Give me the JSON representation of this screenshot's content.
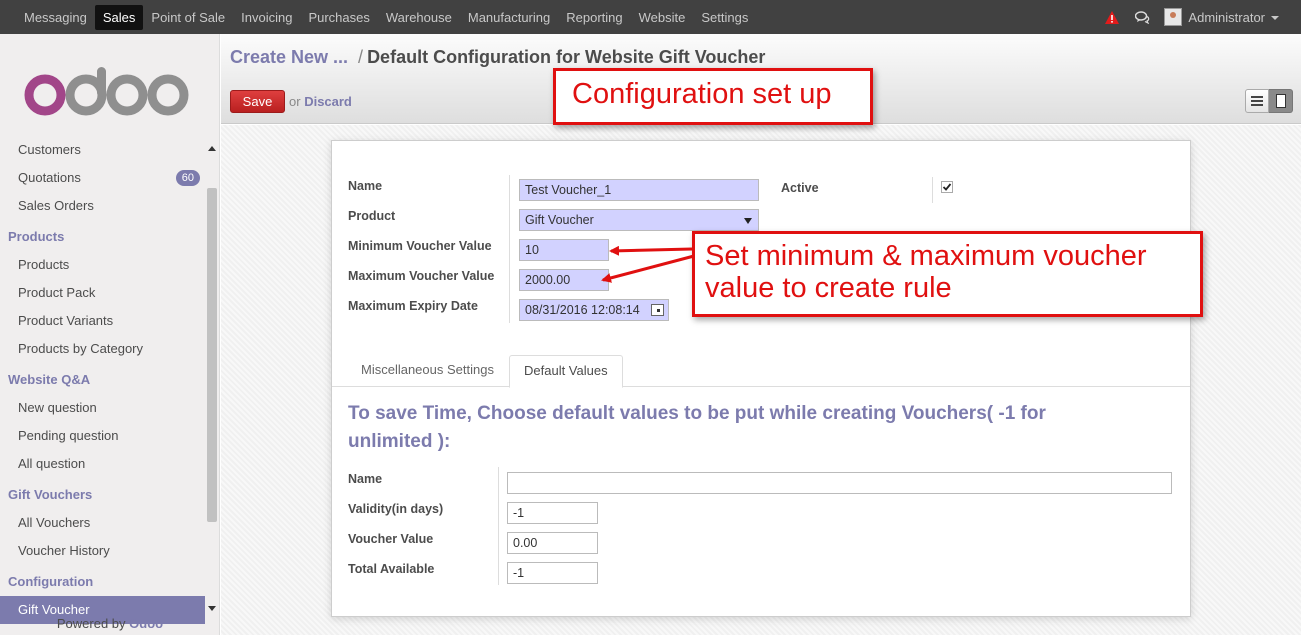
{
  "topbar": {
    "menu": [
      "Messaging",
      "Sales",
      "Point of Sale",
      "Invoicing",
      "Purchases",
      "Warehouse",
      "Manufacturing",
      "Reporting",
      "Website",
      "Settings"
    ],
    "active_index": 1,
    "user": "Administrator"
  },
  "sidebar": {
    "logo_text": "odoo",
    "items": [
      {
        "type": "item",
        "label": "Customers"
      },
      {
        "type": "item",
        "label": "Quotations",
        "badge": "60"
      },
      {
        "type": "item",
        "label": "Sales Orders"
      },
      {
        "type": "section",
        "label": "Products"
      },
      {
        "type": "item",
        "label": "Products"
      },
      {
        "type": "item",
        "label": "Product Pack"
      },
      {
        "type": "item",
        "label": "Product Variants"
      },
      {
        "type": "item",
        "label": "Products by Category"
      },
      {
        "type": "section",
        "label": "Website Q&A"
      },
      {
        "type": "item",
        "label": "New question"
      },
      {
        "type": "item",
        "label": "Pending question"
      },
      {
        "type": "item",
        "label": "All question"
      },
      {
        "type": "section",
        "label": "Gift Vouchers"
      },
      {
        "type": "item",
        "label": "All Vouchers"
      },
      {
        "type": "item",
        "label": "Voucher History"
      },
      {
        "type": "section",
        "label": "Configuration"
      },
      {
        "type": "item",
        "label": "Gift Voucher",
        "selected": true
      }
    ],
    "powered_by": "Powered by",
    "powered_brand": "Odoo"
  },
  "header": {
    "breadcrumb_parent": "Create New ...",
    "breadcrumb_sep": "/",
    "breadcrumb_current": "Default Configuration for Website Gift Voucher",
    "save_label": "Save",
    "or_label": "or",
    "discard_label": "Discard"
  },
  "form": {
    "name_label": "Name",
    "name_value": "Test Voucher_1",
    "product_label": "Product",
    "product_value": "Gift Voucher",
    "min_label": "Minimum Voucher Value",
    "min_value": "10",
    "max_label": "Maximum Voucher Value",
    "max_value": "2000.00",
    "expiry_label": "Maximum Expiry Date",
    "expiry_value": "08/31/2016 12:08:14",
    "active_label": "Active",
    "active_checked": true
  },
  "tabs": [
    {
      "label": "Miscellaneous Settings",
      "active": false
    },
    {
      "label": "Default Values",
      "active": true
    }
  ],
  "defaults": {
    "heading": "To save Time, Choose default values to be put while creating Vouchers( -1 for unlimited ):",
    "name_label": "Name",
    "name_value": "",
    "validity_label": "Validity(in days)",
    "validity_value": "-1",
    "voucher_value_label": "Voucher Value",
    "voucher_value_value": "0.00",
    "total_label": "Total Available",
    "total_value": "-1"
  },
  "annotations": {
    "config": "Configuration set up",
    "minmax_line1": "Set minimum & maximum voucher",
    "minmax_line2": "value to create rule"
  },
  "colors": {
    "accent": "#7c7bad",
    "topbar": "#414141",
    "save": "#dc2f2f",
    "annotation": "#e01010",
    "required_field": "#d2d2ff"
  }
}
